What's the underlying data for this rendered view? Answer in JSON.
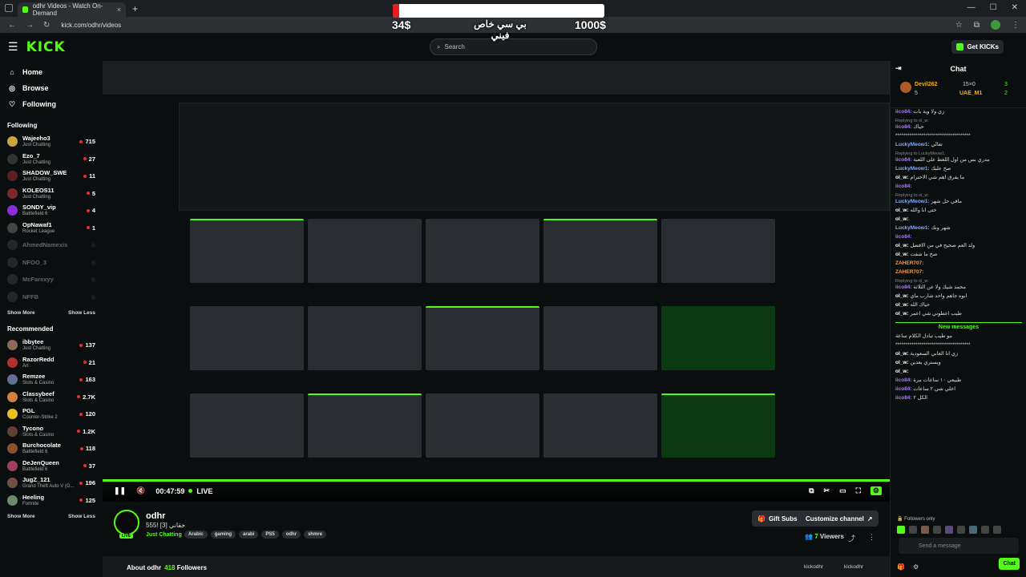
{
  "browser": {
    "tab_title": "odhr Videos - Watch On-Demand",
    "tab_close": "×",
    "new_tab": "+",
    "url": "kick.com/odhr/videos"
  },
  "overlay": {
    "left_amount": "34$",
    "right_amount": "1000$",
    "title": "بي سي خاص فيني",
    "progress_fraction": 0.03
  },
  "header": {
    "logo": "KICK",
    "search_placeholder": "Search",
    "get_kicks": "Get KICKs"
  },
  "sidebar": {
    "nav": [
      {
        "label": "Home",
        "icon": "home-icon"
      },
      {
        "label": "Browse",
        "icon": "compass-icon"
      },
      {
        "label": "Following",
        "icon": "heart-icon"
      }
    ],
    "following_title": "Following",
    "following": [
      {
        "name": "Wajeeho3",
        "game": "Just Chatting",
        "viewers": "715",
        "color": "#c9a440",
        "live": true
      },
      {
        "name": "Ezo_7",
        "game": "Just Chatting",
        "viewers": "27",
        "color": "#333333",
        "live": true
      },
      {
        "name": "SHADOW_SWE",
        "game": "Just Chatting",
        "viewers": "11",
        "color": "#5a2020",
        "live": true
      },
      {
        "name": "KOLEOS11",
        "game": "Just Chatting",
        "viewers": "5",
        "color": "#7a2a2a",
        "live": true
      },
      {
        "name": "SONDY_vip",
        "game": "Battlefield 6",
        "viewers": "4",
        "color": "#8a2be2",
        "live": true
      },
      {
        "name": "OpNawaf1",
        "game": "Rocket League",
        "viewers": "1",
        "color": "#444444",
        "live": true
      },
      {
        "name": "AhmedNamexis",
        "game": "",
        "viewers": "",
        "color": "#555555",
        "live": false
      },
      {
        "name": "NFOO_3",
        "game": "",
        "viewers": "",
        "color": "#555555",
        "live": false
      },
      {
        "name": "McFarexyy",
        "game": "",
        "viewers": "",
        "color": "#555555",
        "live": false
      },
      {
        "name": "NFFB",
        "game": "",
        "viewers": "",
        "color": "#555555",
        "live": false
      }
    ],
    "show_more": "Show More",
    "show_less": "Show Less",
    "recommended_title": "Recommended",
    "recommended": [
      {
        "name": "ibbytee",
        "game": "Just Chatting",
        "viewers": "137",
        "color": "#8a6a5a"
      },
      {
        "name": "RazorRedd",
        "game": "Art",
        "viewers": "21",
        "color": "#b03030"
      },
      {
        "name": "Remzee",
        "game": "Slots & Casino",
        "viewers": "163",
        "color": "#607090"
      },
      {
        "name": "Classybeef",
        "game": "Slots & Casino",
        "viewers": "2.7K",
        "color": "#d08040"
      },
      {
        "name": "PGL",
        "game": "Counter-Strike 2",
        "viewers": "120",
        "color": "#e8c020"
      },
      {
        "name": "Tycono",
        "game": "Slots & Casino",
        "viewers": "1.2K",
        "color": "#604030"
      },
      {
        "name": "Burchocolate",
        "game": "Battlefield 6",
        "viewers": "118",
        "color": "#8a5030"
      },
      {
        "name": "DeJenQueen",
        "game": "Battlefield 6",
        "viewers": "37",
        "color": "#a04060"
      },
      {
        "name": "JugZ_121",
        "game": "Grand Theft Auto V (G...",
        "viewers": "196",
        "color": "#705040"
      },
      {
        "name": "Heeling",
        "game": "Fortnite",
        "viewers": "125",
        "color": "#6a8a6a"
      }
    ]
  },
  "player": {
    "time": "00:47:59",
    "live_label": "LIVE",
    "progress_fraction": 1.0
  },
  "channel": {
    "name": "odhr",
    "title": "555! [3] خقاني",
    "category": "Just Chatting",
    "tags": [
      "Arabic",
      "gaming",
      "arabi",
      "PS5",
      "odhr",
      "shmre"
    ],
    "gift_subs": "Gift Subs",
    "customize": "Customize channel",
    "viewers_count": "7",
    "viewers_label": "Viewers",
    "about": "About odhr",
    "followers": "418",
    "followers_label": "Followers",
    "social_1": "kickodhr",
    "social_2": "kickodhr",
    "live_badge": "LIVE"
  },
  "chat": {
    "title": "Chat",
    "pinned_user1": "Devil262",
    "pinned_user2": "UAE_M1",
    "pinned_val1": "15×0",
    "pinned_a": "3",
    "pinned_b": "2",
    "pinned_c": "5",
    "messages": [
      {
        "user": "iico84:",
        "color": "#a878ff",
        "text": "زي ولا وية بات",
        "reply": ""
      },
      {
        "user": "iico84:",
        "color": "#a878ff",
        "text": "حياك",
        "reply": "Replying to ol_w:"
      },
      {
        "user": "",
        "color": "#ffffff",
        "text": "*************************************",
        "reply": ""
      },
      {
        "user": "LuckyMeow1:",
        "color": "#7fb0ff",
        "text": "تعالي",
        "reply": ""
      },
      {
        "user": "iico84:",
        "color": "#a878ff",
        "text": "مدري بس من اول اللغط على اللعبة",
        "reply": "Replying to LuckyMeow1:"
      },
      {
        "user": "LuckyMeow1:",
        "color": "#7fb0ff",
        "text": "صح عليك",
        "reply": ""
      },
      {
        "user": "ol_w:",
        "color": "#ffffff",
        "text": "ما يفرق اهم شي الاحترام",
        "reply": ""
      },
      {
        "user": "iico84:",
        "color": "#a878ff",
        "text": "",
        "reply": ""
      },
      {
        "user": "LuckyMeow1:",
        "color": "#7fb0ff",
        "text": "مافي حل شهر",
        "reply": "Replying to ol_w:"
      },
      {
        "user": "ol_w:",
        "color": "#ffffff",
        "text": "حتى انا والله",
        "reply": ""
      },
      {
        "user": "ol_w:",
        "color": "#ffffff",
        "text": "",
        "reply": ""
      },
      {
        "user": "LuckyMeow1:",
        "color": "#7fb0ff",
        "text": "شهر ونك",
        "reply": ""
      },
      {
        "user": "iico84:",
        "color": "#a878ff",
        "text": "",
        "reply": ""
      },
      {
        "user": "ol_w:",
        "color": "#ffffff",
        "text": "ولد العم صحيح في من الافضل",
        "reply": ""
      },
      {
        "user": "ol_w:",
        "color": "#ffffff",
        "text": "صح ما شفت",
        "reply": ""
      },
      {
        "user": "ZAHER707:",
        "color": "#ff9a3c",
        "text": "",
        "reply": ""
      },
      {
        "user": "ZAHER707:",
        "color": "#ff9a3c",
        "text": "",
        "reply": ""
      },
      {
        "user": "iico84:",
        "color": "#a878ff",
        "text": "محمد شيك ولا عن الثلاثة",
        "reply": "Replying to ol_w:"
      },
      {
        "user": "ol_w:",
        "color": "#ffffff",
        "text": "ابوه جاهم واحد شارب ماي",
        "reply": ""
      },
      {
        "user": "ol_w:",
        "color": "#ffffff",
        "text": "حياك الله",
        "reply": ""
      },
      {
        "user": "ol_w:",
        "color": "#ffffff",
        "text": "طيب اعطوني شي اعمر",
        "reply": ""
      }
    ],
    "new_messages": "New messages",
    "messages_after": [
      {
        "user": "",
        "color": "#ffffff",
        "text": "مو طيب تبادل الكلام ساعة"
      },
      {
        "user": "",
        "color": "#ffffff",
        "text": "*************************************"
      },
      {
        "user": "ol_w:",
        "color": "#ffffff",
        "text": "زي انا العابي السعودية"
      },
      {
        "user": "ol_w:",
        "color": "#ffffff",
        "text": "ويستري بعدين"
      },
      {
        "user": "ol_w:",
        "color": "#ffffff",
        "text": ""
      },
      {
        "user": "iico84:",
        "color": "#a878ff",
        "text": "طبيعي ١٠ ساعات مرة"
      },
      {
        "user": "iico84:",
        "color": "#a878ff",
        "text": "اخلي شي ٢ ساعات"
      },
      {
        "user": "iico84:",
        "color": "#a878ff",
        "text": "الكل ٢"
      }
    ],
    "followers_only": "Followers only",
    "input_placeholder": "Send a message",
    "chat_button": "Chat"
  }
}
